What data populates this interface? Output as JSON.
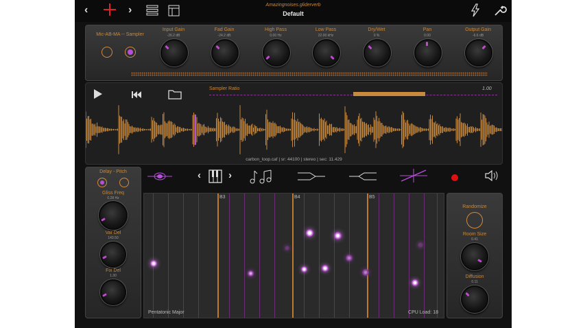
{
  "topbar": {
    "subtitle": "Amazingnoises.gliderverb",
    "preset": "Default"
  },
  "routing": {
    "label": "Mic-AB-MA -- Sampler"
  },
  "knobs": [
    {
      "label": "Input Gain",
      "value": "-26.2 dB"
    },
    {
      "label": "Fad Gain",
      "value": "-24.2 dB"
    },
    {
      "label": "High Pass",
      "value": "0.00 Hz"
    },
    {
      "label": "Low Pass",
      "value": "22.00 kHz"
    },
    {
      "label": "Dry/Wet",
      "value": "0 %"
    },
    {
      "label": "Pan",
      "value": "0.00"
    },
    {
      "label": "Output Gain",
      "value": "-6.6 dB"
    }
  ],
  "sampler": {
    "ratio_label": "Sampler Ratio",
    "ratio_value": "1.00",
    "file_info": "carbon_loop.caf | sr: 44100 | stereo | sec: 11.429"
  },
  "left_panel": {
    "title": "Delay - Pitch",
    "gliss_label": "Gliss Freq",
    "gliss_value": "0.28 Hz",
    "var_label": "Var Del",
    "var_value": "143.50",
    "fix_label": "Fix Del",
    "fix_value": "1.30"
  },
  "grid": {
    "notes": [
      "B3",
      "B4",
      "B5"
    ],
    "scale": "Pentatonic Major",
    "cpu": "CPU Load: 18"
  },
  "right_panel": {
    "randomize": "Randomize",
    "room_label": "Room Size",
    "room_value": "0.41",
    "diffusion_label": "Diffusion",
    "diffusion_value": "0.11"
  },
  "colors": {
    "accent_orange": "#c98a3e",
    "accent_purple": "#b650d8",
    "record_red": "#e01010"
  }
}
